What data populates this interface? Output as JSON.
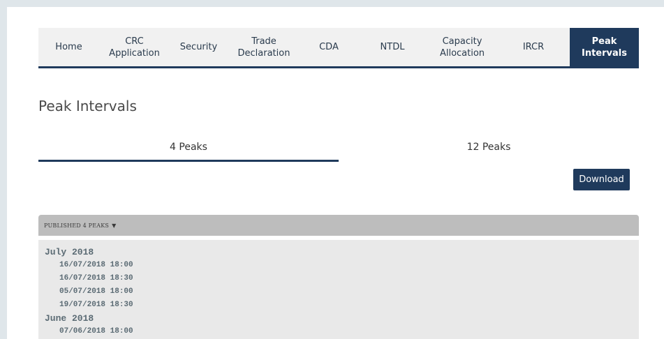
{
  "nav": {
    "items": [
      {
        "label": "Home"
      },
      {
        "label": "CRC\nApplication"
      },
      {
        "label": "Security"
      },
      {
        "label": "Trade\nDeclaration"
      },
      {
        "label": "CDA"
      },
      {
        "label": "NTDL"
      },
      {
        "label": "Capacity\nAllocation"
      },
      {
        "label": "IRCR"
      },
      {
        "label": "Peak\nIntervals"
      }
    ],
    "active_index": 8
  },
  "page_title": "Peak Intervals",
  "tabs": {
    "items": [
      {
        "label": "4 Peaks"
      },
      {
        "label": "12 Peaks"
      }
    ],
    "selected": "4 Peaks"
  },
  "download_label": "Download",
  "panel": {
    "header": "PUBLISHED 4 PEAKS",
    "groups": [
      {
        "month": "July 2018",
        "peaks": [
          "16/07/2018 18:00",
          "16/07/2018 18:30",
          "05/07/2018 18:00",
          "19/07/2018 18:30"
        ]
      },
      {
        "month": "June 2018",
        "peaks": [
          "07/06/2018 18:00"
        ]
      }
    ]
  },
  "colors": {
    "primary": "#1f3a5c",
    "nav_bg": "#f1f1f1",
    "panel_header": "#bdbdbd",
    "panel_body": "#e9e9e9"
  }
}
